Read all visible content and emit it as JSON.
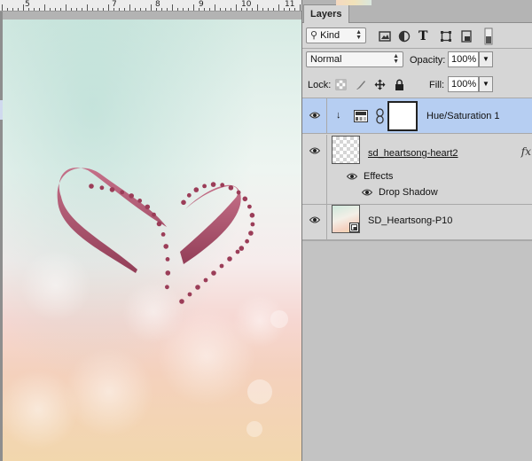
{
  "ruler": {
    "labels": [
      "5",
      "7",
      "8",
      "9",
      "10",
      "11"
    ]
  },
  "panel": {
    "tab_label": "Layers",
    "filter": {
      "kind_label": "Kind"
    },
    "blend_mode": "Normal",
    "opacity_label": "Opacity:",
    "opacity_value": "100%",
    "lock_label": "Lock:",
    "fill_label": "Fill:",
    "fill_value": "100%"
  },
  "layers": [
    {
      "name": "Hue/Saturation 1",
      "type": "adjustment",
      "selected": true
    },
    {
      "name": "sd_heartsong-heart2",
      "type": "pixel",
      "fx_badge": "fx",
      "effects_label": "Effects",
      "effects": [
        "Drop Shadow"
      ]
    },
    {
      "name": "SD_Heartsong-P10",
      "type": "smart-object"
    }
  ],
  "colors": {
    "selection": "#b6cef2",
    "panel_bg": "#d6d6d6",
    "heart": "#a84a62"
  }
}
